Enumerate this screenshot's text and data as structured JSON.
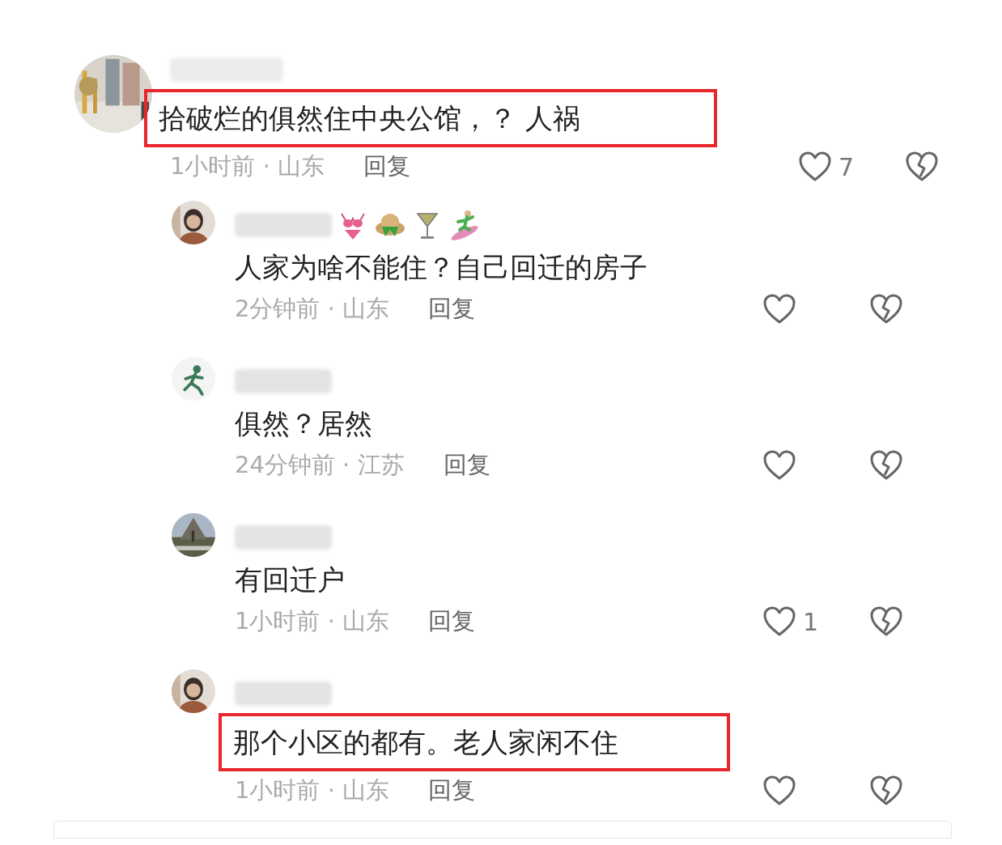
{
  "comments": [
    {
      "kind": "comment",
      "name_emojis": false,
      "text": "拾破烂的俱然住中央公馆，？ 人祸",
      "meta": "1小时前 · 山东",
      "reply": "回复",
      "likes": "7",
      "highlighted": true
    },
    {
      "kind": "reply",
      "name_emojis": true,
      "text": "人家为啥不能住？自己回迁的房子",
      "meta": "2分钟前 · 山东",
      "reply": "回复",
      "highlighted": false
    },
    {
      "kind": "reply",
      "name_emojis": false,
      "text": "俱然？居然",
      "meta": "24分钟前 · 江苏",
      "reply": "回复",
      "highlighted": false
    },
    {
      "kind": "reply",
      "name_emojis": false,
      "text": "有回迁户",
      "meta": "1小时前 · 山东",
      "reply": "回复",
      "likes": "1",
      "highlighted": false
    },
    {
      "kind": "reply",
      "name_emojis": false,
      "text": "那个小区的都有。老人家闲不住",
      "meta": "1小时前 · 山东",
      "reply": "回复",
      "highlighted": true
    }
  ]
}
